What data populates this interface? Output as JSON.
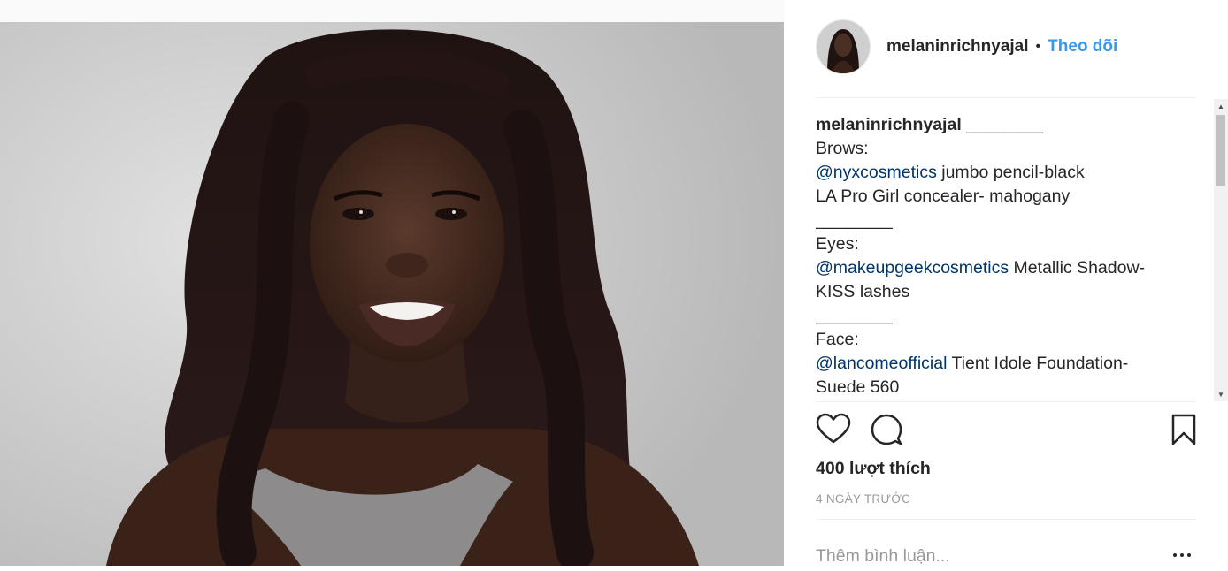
{
  "post": {
    "username": "melaninrichnyajal",
    "separator": "•",
    "follow_label": "Theo dõi",
    "caption_suffix": "________",
    "caption_lines": [
      {
        "text": "Brows:"
      },
      {
        "mention": "@nyxcosmetics",
        "text": " jumbo pencil-black"
      },
      {
        "text": "LA Pro Girl concealer- mahogany"
      },
      {
        "text": "________"
      },
      {
        "text": "Eyes:"
      },
      {
        "mention": "@makeupgeekcosmetics",
        "text": " Metallic Shadow-"
      },
      {
        "text": "KISS lashes"
      },
      {
        "text": "________"
      },
      {
        "text": "Face:"
      },
      {
        "mention": "@lancomeofficial",
        "text": " Tient Idole Foundation-"
      },
      {
        "text": "Suede 560"
      }
    ],
    "likes": "400 lượt thích",
    "time_ago": "4 NGÀY TRƯỚC",
    "comment_placeholder": "Thêm bình luận..."
  },
  "icons": {
    "like": "heart-icon",
    "comment": "comment-bubble-icon",
    "save": "bookmark-icon",
    "more": "more-options-icon"
  },
  "colors": {
    "link": "#3897f0",
    "mention": "#003569",
    "text": "#262626",
    "muted": "#999999"
  }
}
